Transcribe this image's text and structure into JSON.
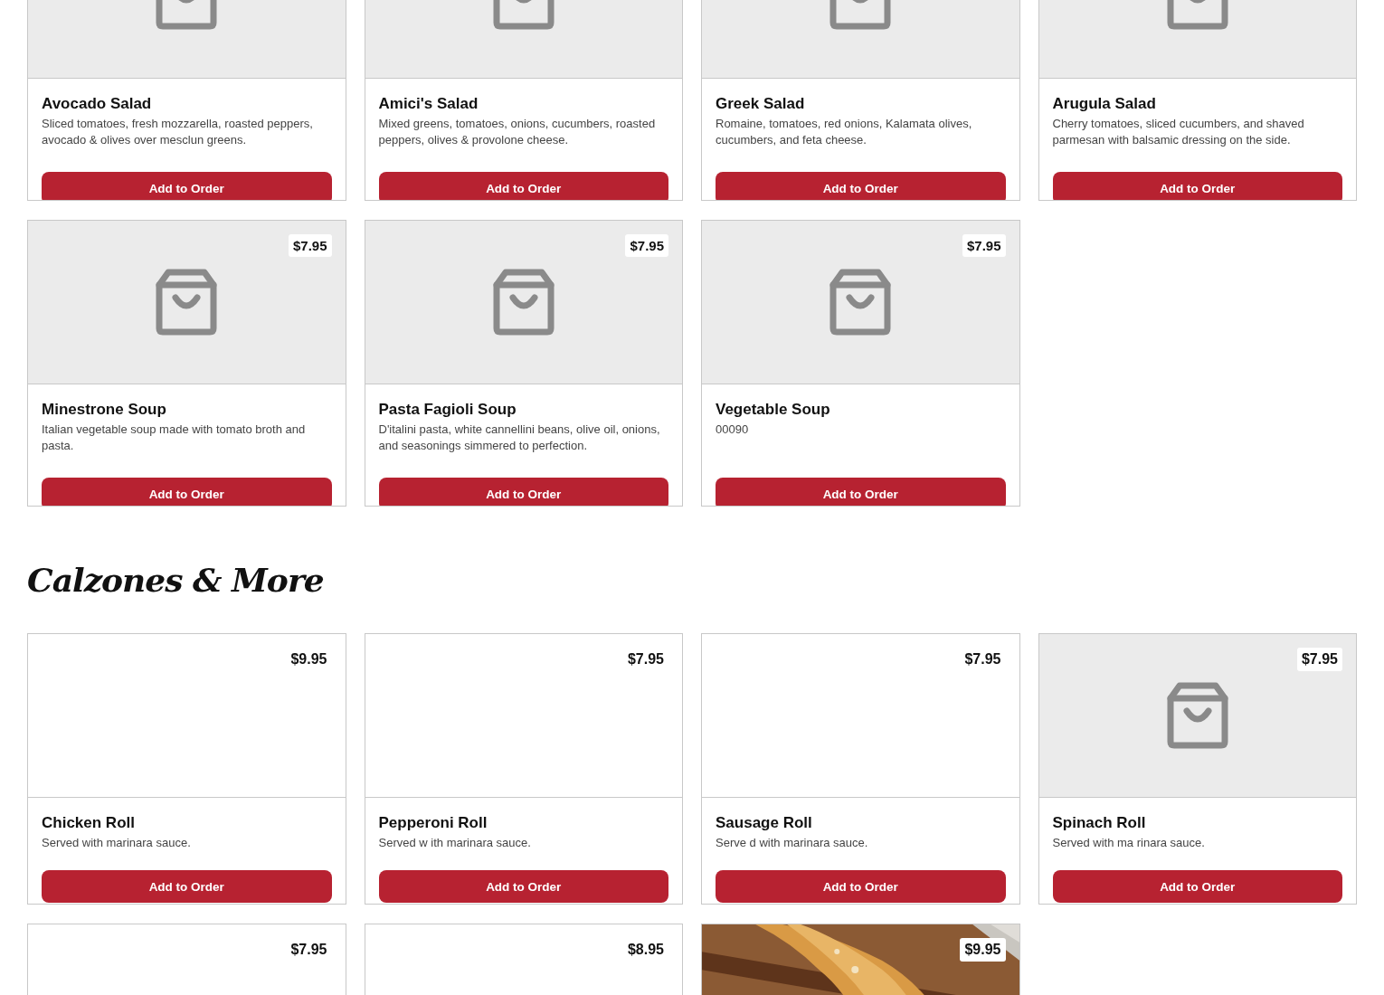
{
  "sections": [
    {
      "items": [
        {
          "image": {
            "kind": "placeholder"
          },
          "name": "Avocado Salad",
          "description": "Sliced tomatoes, fresh mozzarella, roasted peppers, avocado & olives over mesclun greens.",
          "button": "Add to Order"
        },
        {
          "image": {
            "kind": "placeholder"
          },
          "name": "Amici's Salad",
          "description": "Mixed greens, tomatoes, onions, cucumbers, roasted peppers, olives & provolone cheese.",
          "button": "Add to Order"
        },
        {
          "image": {
            "kind": "placeholder"
          },
          "name": "Greek Salad",
          "description": "Romaine, tomatoes, red onions, Kalamata olives, cucumbers, and feta cheese.",
          "button": "Add to Order"
        },
        {
          "image": {
            "kind": "placeholder"
          },
          "name": "Arugula Salad",
          "description": "Cherry tomatoes, sliced cucumbers, and shaved parmesan with balsamic dressing on the side.",
          "button": "Add to Order"
        },
        {
          "image": {
            "kind": "placeholder"
          },
          "price": "$7.95",
          "name": "Minestrone Soup",
          "description": "Italian vegetable soup made with tomato broth and pasta.",
          "button": "Add to Order"
        },
        {
          "image": {
            "kind": "placeholder"
          },
          "price": "$7.95",
          "name": "Pasta Fagioli Soup",
          "description": "D'italini pasta, white cannellini beans, olive oil, onions, and seasonings simmered to perfection.",
          "button": "Add to Order"
        },
        {
          "image": {
            "kind": "placeholder"
          },
          "price": "$7.95",
          "name": "Vegetable Soup",
          "description": "00090",
          "button": "Add to Order"
        }
      ]
    },
    {
      "title": "Calzones & More",
      "items": [
        {
          "image": {
            "kind": "blank"
          },
          "price": "$9.95",
          "name": "Chicken Roll",
          "description": "Served with marinara sauce.",
          "button": "Add to Order"
        },
        {
          "image": {
            "kind": "blank"
          },
          "price": "$7.95",
          "name": "Pepperoni Roll",
          "description": "Served w ith marinara sauce.",
          "button": "Add to Order"
        },
        {
          "image": {
            "kind": "blank"
          },
          "price": "$7.95",
          "name": "Sausage Roll",
          "description": "Serve d with marinara sauce.",
          "button": "Add to Order"
        },
        {
          "image": {
            "kind": "placeholder"
          },
          "price": "$7.95",
          "name": "Spinach Roll",
          "description": "Served with ma rinara sauce.",
          "button": "Add to Order"
        },
        {
          "image": {
            "kind": "blank"
          },
          "price": "$7.95"
        },
        {
          "image": {
            "kind": "blank"
          },
          "price": "$8.95"
        },
        {
          "price": "$9.95"
        }
      ]
    }
  ]
}
